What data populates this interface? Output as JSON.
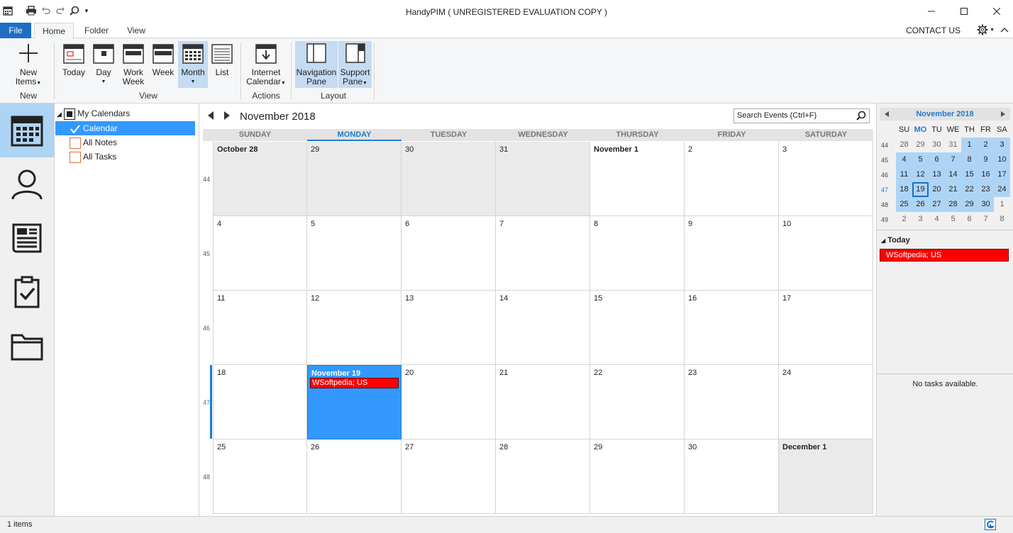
{
  "window": {
    "title": "HandyPIM ( UNREGISTERED EVALUATION COPY )"
  },
  "tabs": {
    "file": "File",
    "home": "Home",
    "folder": "Folder",
    "view": "View",
    "contact": "CONTACT US"
  },
  "ribbon": {
    "new_items": [
      "New",
      "Items"
    ],
    "today": "Today",
    "day": "Day",
    "work_week": [
      "Work",
      "Week"
    ],
    "week": "Week",
    "month": "Month",
    "list": "List",
    "internet_calendar": [
      "Internet",
      "Calendar"
    ],
    "navigation_pane": [
      "Navigation",
      "Pane"
    ],
    "support_pane": [
      "Support",
      "Pane"
    ],
    "groups": {
      "new": "New",
      "view": "View",
      "actions": "Actions",
      "layout": "Layout"
    }
  },
  "tree": {
    "root": "My Calendars",
    "items": [
      "Calendar",
      "All Notes",
      "All Tasks"
    ]
  },
  "calendar": {
    "month_title": "November 2018",
    "search_placeholder": "Search Events (Ctrl+F)",
    "days": [
      "SUNDAY",
      "MONDAY",
      "TUESDAY",
      "WEDNESDAY",
      "THURSDAY",
      "FRIDAY",
      "SATURDAY"
    ],
    "week_numbers": [
      "44",
      "45",
      "46",
      "47",
      "48"
    ],
    "weeks": [
      [
        "October 28",
        "29",
        "30",
        "31",
        "November 1",
        "2",
        "3"
      ],
      [
        "4",
        "5",
        "6",
        "7",
        "8",
        "9",
        "10"
      ],
      [
        "11",
        "12",
        "13",
        "14",
        "15",
        "16",
        "17"
      ],
      [
        "18",
        "November 19",
        "20",
        "21",
        "22",
        "23",
        "24"
      ],
      [
        "25",
        "26",
        "27",
        "28",
        "29",
        "30",
        "December 1"
      ]
    ],
    "event": "WSoftpedia; US"
  },
  "mini": {
    "title": "November 2018",
    "dow": [
      "SU",
      "MO",
      "TU",
      "WE",
      "TH",
      "FR",
      "SA"
    ],
    "weeks": [
      "44",
      "45",
      "46",
      "47",
      "48",
      "49"
    ],
    "days": [
      [
        "28",
        "29",
        "30",
        "31",
        "1",
        "2",
        "3"
      ],
      [
        "4",
        "5",
        "6",
        "7",
        "8",
        "9",
        "10"
      ],
      [
        "11",
        "12",
        "13",
        "14",
        "15",
        "16",
        "17"
      ],
      [
        "18",
        "19",
        "20",
        "21",
        "22",
        "23",
        "24"
      ],
      [
        "25",
        "26",
        "27",
        "28",
        "29",
        "30",
        "1"
      ],
      [
        "2",
        "3",
        "4",
        "5",
        "6",
        "7",
        "8"
      ]
    ],
    "today_label": "Today",
    "today_event": "WSoftpedia; US",
    "no_tasks": "No tasks available."
  },
  "status": {
    "text": "1 items"
  },
  "colors": {
    "accent": "#1e6fc3",
    "selection": "#3399ff",
    "event": "#ff0000",
    "highlight": "#aed4f5"
  }
}
